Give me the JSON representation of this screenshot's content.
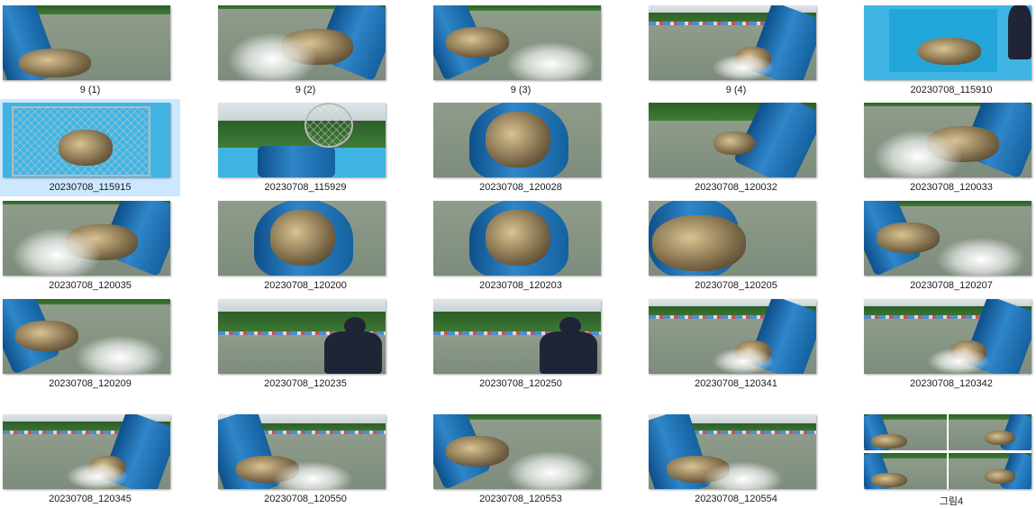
{
  "view": "file-explorer-large-icons",
  "selected_index": 5,
  "files": [
    {
      "name": "9 (1)",
      "scene": "bucket-left"
    },
    {
      "name": "9 (2)",
      "scene": "bucket-right-splash"
    },
    {
      "name": "9 (3)",
      "scene": "bucket-left-splash"
    },
    {
      "name": "9 (4)",
      "scene": "bucket-right-trees"
    },
    {
      "name": "20230708_115910",
      "scene": "boat"
    },
    {
      "name": "20230708_115915",
      "scene": "net"
    },
    {
      "name": "20230708_115929",
      "scene": "boat-net"
    },
    {
      "name": "20230708_120028",
      "scene": "bucket-top"
    },
    {
      "name": "20230708_120032",
      "scene": "bucket-right"
    },
    {
      "name": "20230708_120033",
      "scene": "bucket-right-splash"
    },
    {
      "name": "20230708_120035",
      "scene": "bucket-right-splash"
    },
    {
      "name": "20230708_120200",
      "scene": "bucket-top"
    },
    {
      "name": "20230708_120203",
      "scene": "bucket-top"
    },
    {
      "name": "20230708_120205",
      "scene": "bucket-full"
    },
    {
      "name": "20230708_120207",
      "scene": "bucket-left-splash"
    },
    {
      "name": "20230708_120209",
      "scene": "bucket-left-splash"
    },
    {
      "name": "20230708_120235",
      "scene": "angler"
    },
    {
      "name": "20230708_120250",
      "scene": "angler"
    },
    {
      "name": "20230708_120341",
      "scene": "bucket-right-trees"
    },
    {
      "name": "20230708_120342",
      "scene": "bucket-right-trees"
    },
    {
      "name": "20230708_120345",
      "scene": "bucket-right-trees"
    },
    {
      "name": "20230708_120550",
      "scene": "bucket-left-trees"
    },
    {
      "name": "20230708_120553",
      "scene": "bucket-left-splash"
    },
    {
      "name": "20230708_120554",
      "scene": "bucket-left-trees"
    },
    {
      "name": "그림4",
      "scene": "collage"
    }
  ],
  "colors": {
    "water": "#8a9a86",
    "bucket": "#1f6fb2",
    "trees": "#2f6b2c",
    "selection": "#cce8ff"
  }
}
